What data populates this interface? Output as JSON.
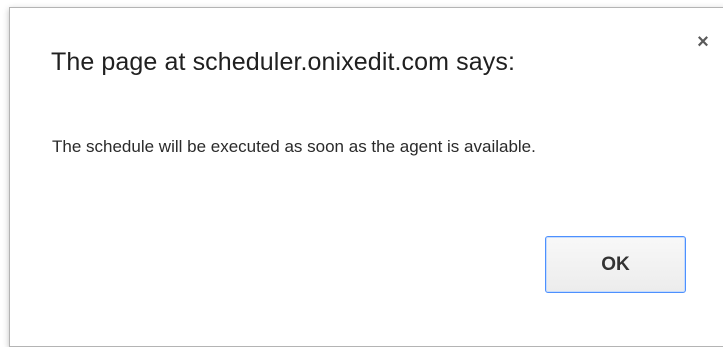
{
  "dialog": {
    "title": "The page at scheduler.onixedit.com says:",
    "close_icon": "close-icon",
    "close_glyph": "×",
    "message": "The schedule will be executed as soon as the agent is available.",
    "ok_label": "OK"
  }
}
